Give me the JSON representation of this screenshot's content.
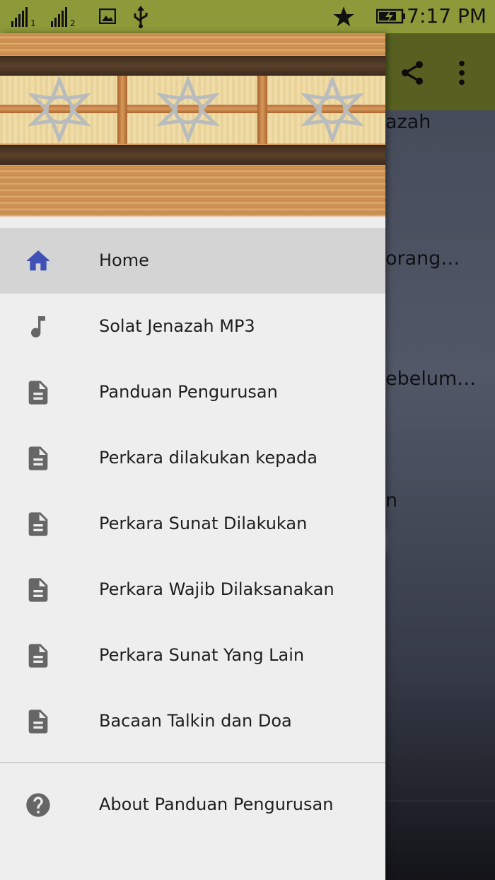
{
  "status_bar": {
    "time": "7:17 PM",
    "sim1": "1",
    "sim2": "2",
    "icons": [
      "signal-icon",
      "signal-icon",
      "image-icon",
      "usb-icon",
      "star-icon",
      "battery-charging-icon"
    ]
  },
  "background_app": {
    "toolbar_icons": [
      "share-icon",
      "more-vert-icon"
    ],
    "visible_text": [
      "azah",
      "orang…",
      "ebelum…",
      "n"
    ]
  },
  "drawer": {
    "menu": [
      {
        "label": "Home",
        "icon": "home-icon",
        "active": true
      },
      {
        "label": "Solat Jenazah MP3",
        "icon": "music-note-icon"
      },
      {
        "label": "Panduan Pengurusan",
        "icon": "document-icon"
      },
      {
        "label": "Perkara dilakukan kepada",
        "icon": "document-icon"
      },
      {
        "label": "Perkara Sunat Dilakukan",
        "icon": "document-icon"
      },
      {
        "label": "Perkara Wajib Dilaksanakan",
        "icon": "document-icon"
      },
      {
        "label": "Perkara Sunat Yang Lain",
        "icon": "document-icon"
      },
      {
        "label": "Bacaan Talkin dan Doa",
        "icon": "document-icon"
      }
    ],
    "footer_item": {
      "label": "About Panduan Pengurusan",
      "icon": "help-icon"
    }
  },
  "colors": {
    "status_bar": "#8c9a3a",
    "toolbar": "#7b862e",
    "drawer_bg": "#eeeeee",
    "active_item_bg": "#d4d4d4",
    "home_icon": "#3f51b5",
    "icon_gray": "#666666"
  }
}
